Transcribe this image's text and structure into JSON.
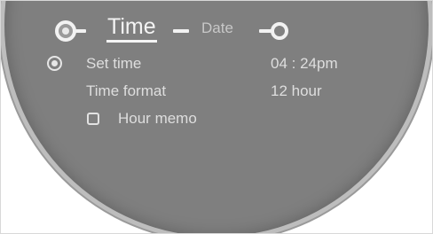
{
  "tabs": {
    "active_label": "Time",
    "next_label": "Date"
  },
  "settings": [
    {
      "label": "Set time",
      "value": "04 : 24pm",
      "selected": true
    },
    {
      "label": "Time format",
      "value": "12 hour"
    }
  ],
  "hour_memo": {
    "label": "Hour memo",
    "checked": false
  },
  "colors": {
    "screen_background": "#7f7f7f",
    "text": "#dedede",
    "highlight": "#f4f4f4"
  }
}
